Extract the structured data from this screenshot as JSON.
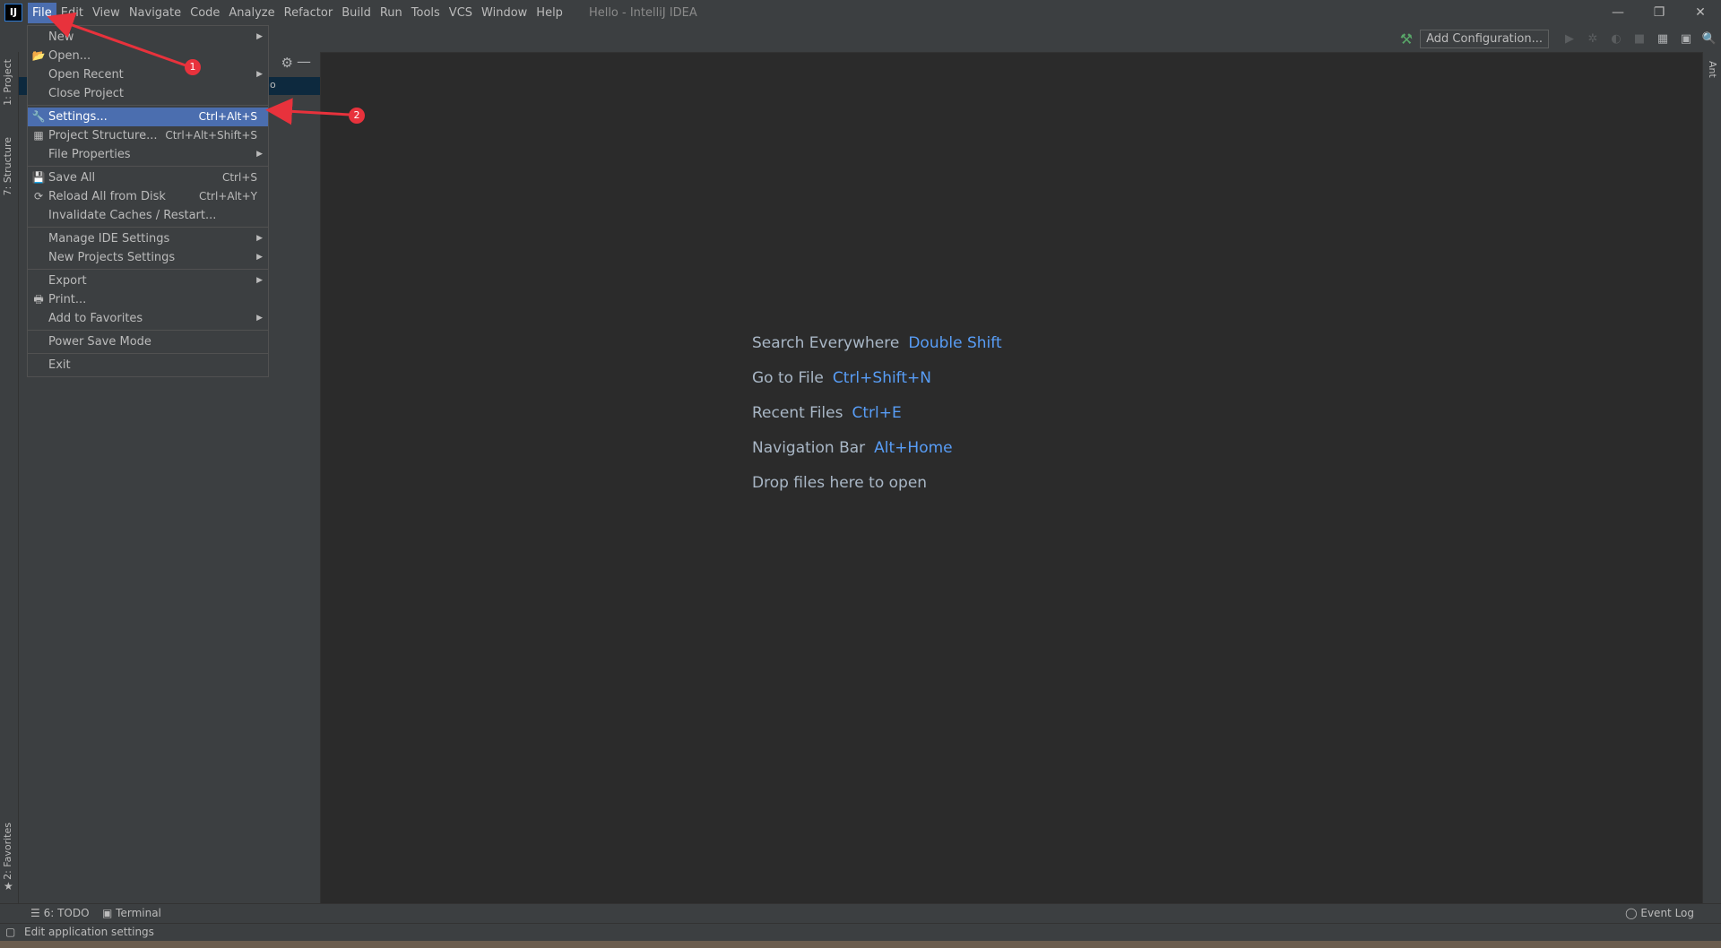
{
  "titlebar": {
    "logo_text": "IJ",
    "menus": [
      "File",
      "Edit",
      "View",
      "Navigate",
      "Code",
      "Analyze",
      "Refactor",
      "Build",
      "Run",
      "Tools",
      "VCS",
      "Window",
      "Help"
    ],
    "title": "Hello - IntelliJ IDEA",
    "minimize_glyph": "—",
    "restore_glyph": "❐",
    "close_glyph": "✕"
  },
  "toolbar": {
    "hammer_glyph": "⚒",
    "add_configuration_label": "Add Configuration...",
    "run_glyph": "▶",
    "debug_glyph": "✲",
    "coverage_glyph": "◐",
    "stop_glyph": "■",
    "project_structure_glyph": "▦",
    "layout_glyph": "▣",
    "search_glyph": "🔍"
  },
  "left_strip": {
    "project_tab": "1: Project",
    "structure_tab": "7: Structure",
    "favorites_tab": "2: Favorites",
    "favorites_star": "★"
  },
  "right_strip": {
    "ant_tab": "Ant"
  },
  "project_panel": {
    "gear_glyph": "⚙",
    "minimize_glyph": "—",
    "sel_row_text": "o"
  },
  "file_menu": {
    "items": {
      "new": {
        "label": "New",
        "arrow": "▶"
      },
      "open": {
        "label": "Open...",
        "icon": "📂"
      },
      "open_recent": {
        "label": "Open Recent",
        "arrow": "▶"
      },
      "close_project": {
        "label": "Close Project"
      },
      "settings": {
        "label": "Settings...",
        "shortcut": "Ctrl+Alt+S",
        "icon": "🔧"
      },
      "project_structure": {
        "label": "Project Structure...",
        "shortcut": "Ctrl+Alt+Shift+S",
        "icon": "▦"
      },
      "file_properties": {
        "label": "File Properties",
        "arrow": "▶"
      },
      "save_all": {
        "label": "Save All",
        "shortcut": "Ctrl+S",
        "icon": "💾"
      },
      "reload": {
        "label": "Reload All from Disk",
        "shortcut": "Ctrl+Alt+Y",
        "icon": "⟳"
      },
      "invalidate": {
        "label": "Invalidate Caches / Restart..."
      },
      "manage_ide": {
        "label": "Manage IDE Settings",
        "arrow": "▶"
      },
      "new_projects": {
        "label": "New Projects Settings",
        "arrow": "▶"
      },
      "export": {
        "label": "Export",
        "arrow": "▶"
      },
      "print": {
        "label": "Print...",
        "icon": "🖶"
      },
      "add_favorites": {
        "label": "Add to Favorites",
        "arrow": "▶"
      },
      "power_save": {
        "label": "Power Save Mode"
      },
      "exit": {
        "label": "Exit"
      }
    }
  },
  "editor_hints": [
    {
      "label": "Search Everywhere",
      "key": "Double Shift"
    },
    {
      "label": "Go to File",
      "key": "Ctrl+Shift+N"
    },
    {
      "label": "Recent Files",
      "key": "Ctrl+E"
    },
    {
      "label": "Navigation Bar",
      "key": "Alt+Home"
    }
  ],
  "drop_hint": "Drop files here to open",
  "bottom_tabs": {
    "todo": "6: TODO",
    "todo_glyph": "☰",
    "terminal": "Terminal",
    "terminal_glyph": "▣",
    "event_log": "Event Log",
    "event_log_glyph": "◯"
  },
  "statusbar": {
    "text": "Edit application settings",
    "icon_glyph": "▢"
  },
  "annotations": {
    "badge1": "1",
    "badge2": "2",
    "arrow_color": "#e8323c"
  }
}
